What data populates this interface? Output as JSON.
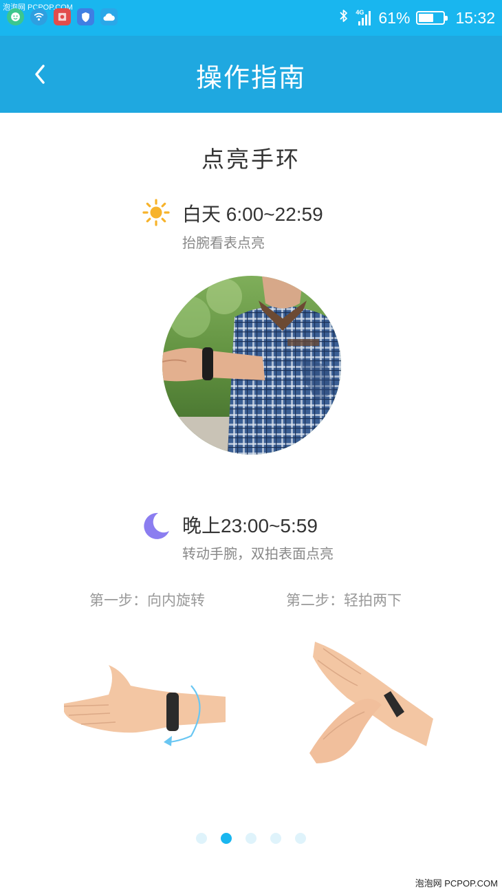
{
  "status_bar": {
    "watermark": "泡泡网 PCPOP.COM",
    "network": "4G",
    "battery": "61%",
    "battery_level": 0.61,
    "time": "15:32",
    "notification_icons": [
      "chat-icon",
      "wifi-app-icon",
      "red-app-icon",
      "shield-icon",
      "cloud-icon"
    ]
  },
  "header": {
    "title": "操作指南",
    "back_icon": "chevron-left-icon"
  },
  "content": {
    "section_title": "点亮手环",
    "day": {
      "icon": "sun-icon",
      "heading": "白天 6:00~22:59",
      "subtitle": "抬腕看表点亮"
    },
    "night": {
      "icon": "moon-icon",
      "heading": "晚上23:00~5:59",
      "subtitle": "转动手腕，双拍表面点亮"
    },
    "steps": [
      {
        "label": "第一步：向内旋转"
      },
      {
        "label": "第二步：轻拍两下"
      }
    ]
  },
  "pager": {
    "count": 5,
    "active_index": 1
  },
  "footer_watermark": "泡泡网 PCPOP.COM",
  "colors": {
    "status_bar": "#19b6ef",
    "app_bar": "#1fa8e0",
    "accent": "#19b6ef",
    "sun": "#f7b32b",
    "moon": "#8b7df0",
    "text_primary": "#333333",
    "text_secondary": "#888888"
  }
}
